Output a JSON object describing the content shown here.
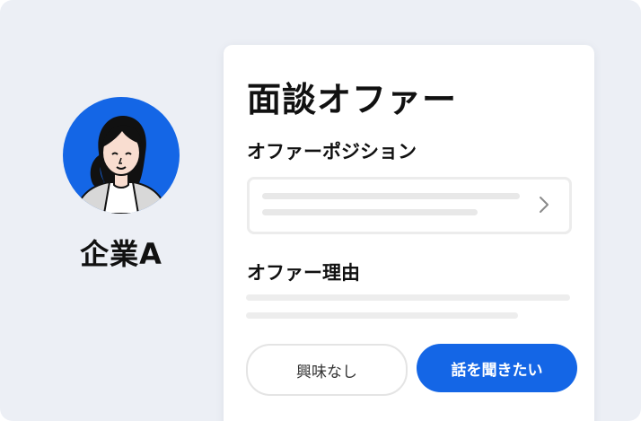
{
  "company": {
    "name": "企業A",
    "avatar_icon": "woman-avatar-icon",
    "avatar_bg": "#1466e6"
  },
  "offer_card": {
    "title": "面談オファー",
    "position_label": "オファーポジション",
    "position_select_icon": "chevron-right-icon",
    "reason_label": "オファー理由",
    "buttons": {
      "decline_label": "興味なし",
      "accept_label": "話を聞きたい"
    }
  },
  "colors": {
    "accent": "#1466e6",
    "background": "#eceff5"
  }
}
